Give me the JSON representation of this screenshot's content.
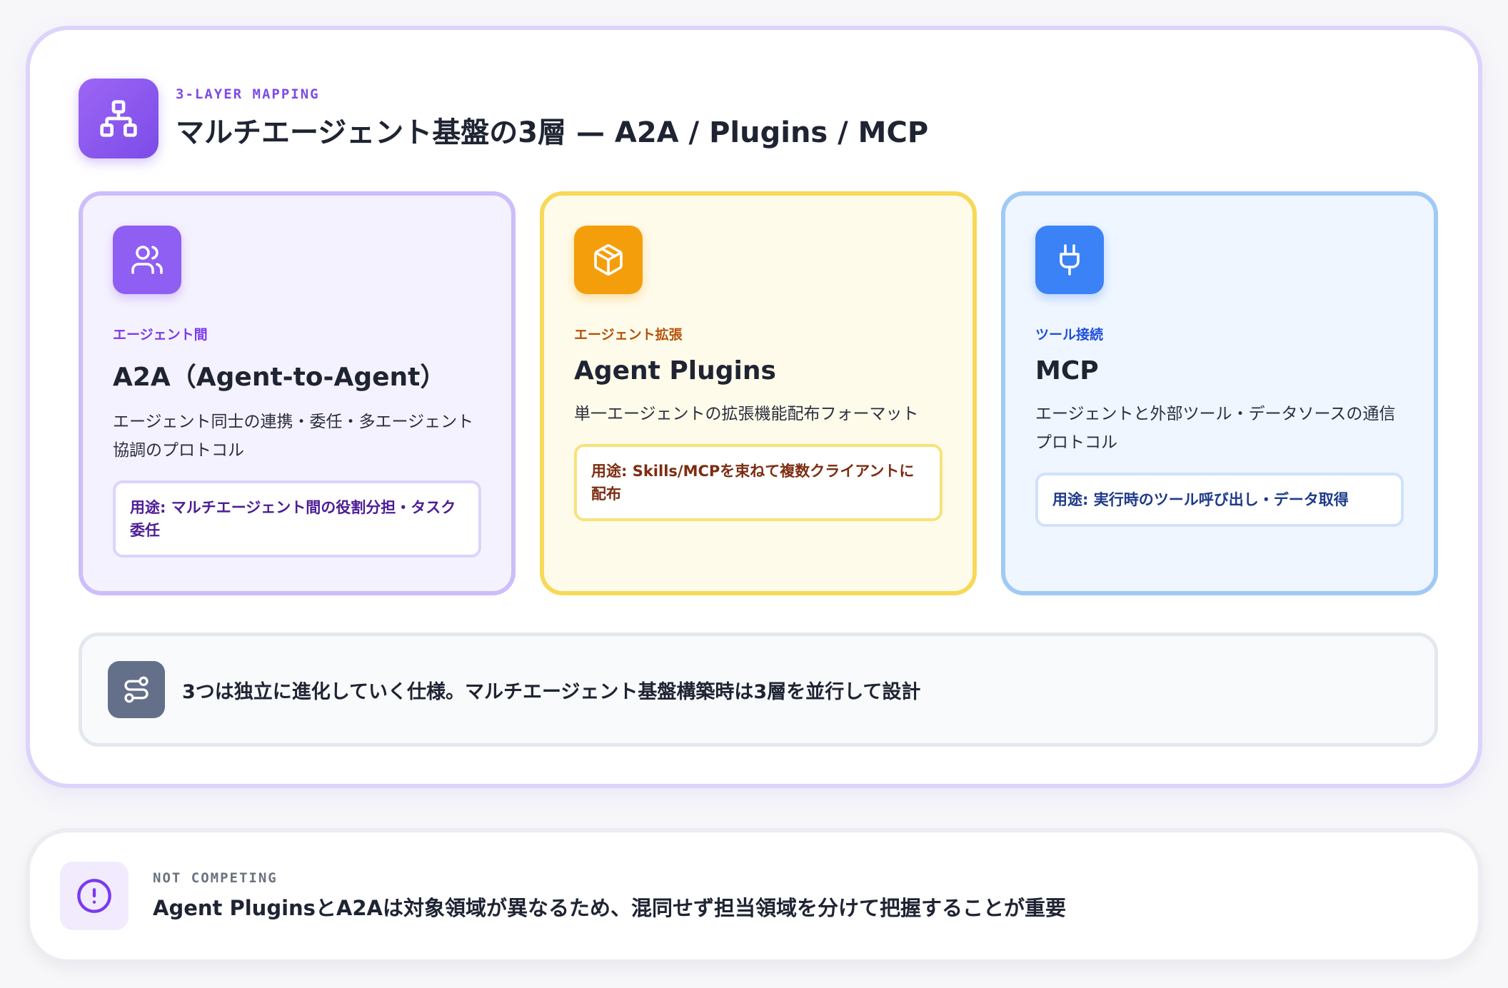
{
  "header": {
    "eyebrow": "3-LAYER MAPPING",
    "title": "マルチエージェント基盤の3層 — A2A / Plugins / MCP",
    "icon": "hierarchy-icon"
  },
  "cards": [
    {
      "tag": "エージェント間",
      "title": "A2A（Agent-to-Agent）",
      "description": "エージェント同士の連携・委任・多エージェント協調のプロトコル",
      "usage": "用途: マルチエージェント間の役割分担・タスク委任",
      "icon": "users-icon",
      "accent": "#8f5ef2"
    },
    {
      "tag": "エージェント拡張",
      "title": "Agent Plugins",
      "description": "単一エージェントの拡張機能配布フォーマット",
      "usage": "用途: Skills/MCPを束ねて複数クライアントに配布",
      "icon": "package-icon",
      "accent": "#f59e0b"
    },
    {
      "tag": "ツール接続",
      "title": "MCP",
      "description": "エージェントと外部ツール・データソースの通信プロトコル",
      "usage": "用途: 実行時のツール呼び出し・データ取得",
      "icon": "plug-icon",
      "accent": "#3b82f6"
    }
  ],
  "note": {
    "text": "3つは独立に進化していく仕様。マルチエージェント基盤構築時は3層を並行して設計",
    "icon": "route-icon"
  },
  "bottom": {
    "eyebrow": "NOT COMPETING",
    "text": "Agent PluginsとA2Aは対象領域が異なるため、混同せず担当領域を分けて把握することが重要",
    "icon": "alert-circle-icon"
  }
}
